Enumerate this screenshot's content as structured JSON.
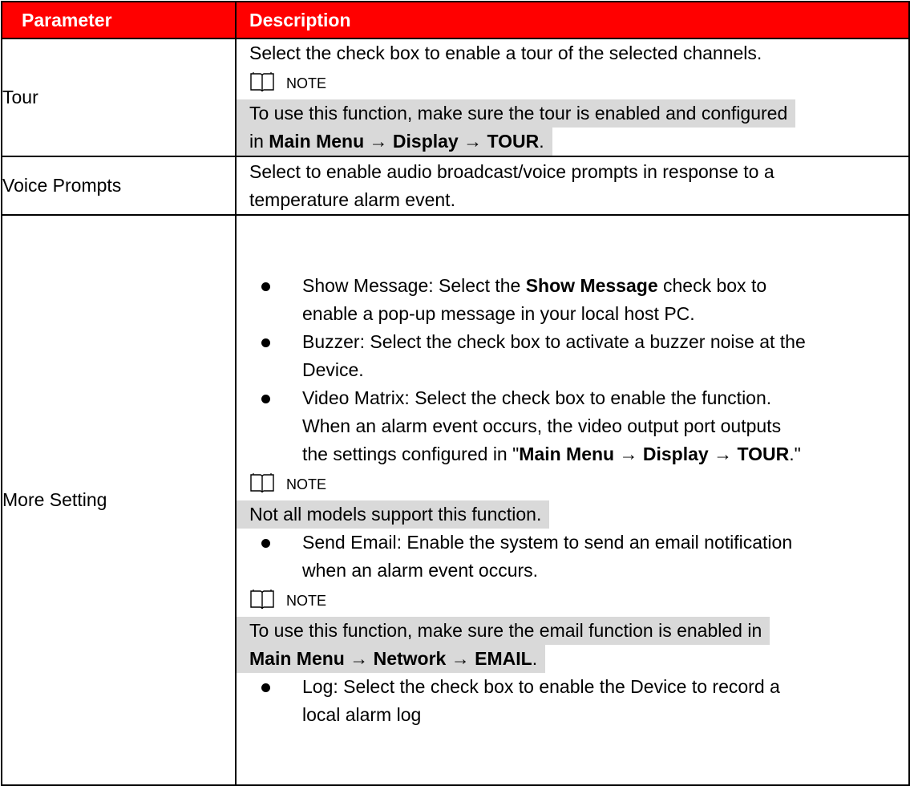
{
  "header": {
    "col1": "Parameter",
    "col2": "Description"
  },
  "colors": {
    "header_bg": "#ff0000",
    "header_text": "#ffffff",
    "note_highlight": "#d9d9d9"
  },
  "rows": {
    "tour": {
      "param": "Tour",
      "line1": "Select the check box to enable a tour of the selected channels.",
      "note_label": "NOTE",
      "note_line1": "To use this function, make sure the tour is enabled and configured",
      "note_line2_pre": "in ",
      "note_line2_path": "Main Menu → Display → TOUR",
      "note_line2_post": "."
    },
    "voice": {
      "param": "Voice Prompts",
      "line1": "Select to enable audio broadcast/voice prompts in response to a",
      "line2": "temperature alarm event."
    },
    "more": {
      "param": "More Setting",
      "show_msg_pre": "Show Message: Select the ",
      "show_msg_bold": "Show Message",
      "show_msg_post": " check box to",
      "show_msg_line2": "enable a pop-up message in your local host PC.",
      "buzzer_line1": "Buzzer: Select the check box to activate a buzzer noise at the",
      "buzzer_line2": "Device.",
      "matrix_line1": "Video Matrix: Select the check box to enable the function.",
      "matrix_line2": "When an alarm event occurs, the video output port outputs",
      "matrix_line3_pre": "the settings configured in \"",
      "matrix_line3_path": "Main Menu → Display → TOUR",
      "matrix_line3_post": ".\"",
      "note1_label": "NOTE",
      "note1_text": "Not all models support this function.",
      "email_line1": "Send Email: Enable the system to send an email notification",
      "email_line2": "when an alarm event occurs.",
      "note2_label": "NOTE",
      "note2_line1": "To use this function, make sure the email function is enabled in",
      "note2_line2_path": "Main Menu → Network → EMAIL",
      "note2_line2_post": ".",
      "log_line1": "Log: Select the check box to enable the Device to record a",
      "log_line2": "local alarm log"
    }
  }
}
